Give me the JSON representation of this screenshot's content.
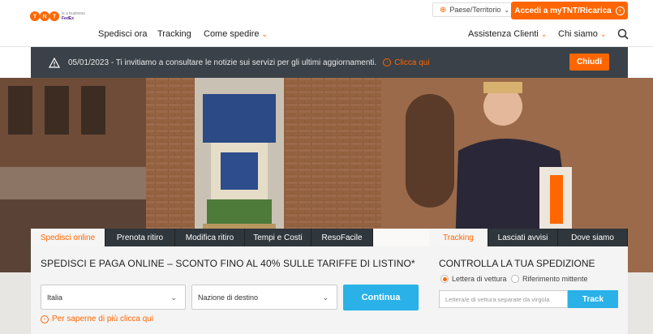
{
  "brand": {
    "logo_text": "TNT",
    "sub_line1": "is a business",
    "sub_line2": "FedEx"
  },
  "header": {
    "country_label": "Paese/Territorio",
    "login_label": "Accedi a myTNT/Ricarica",
    "nav": [
      {
        "label": "Spedisci ora"
      },
      {
        "label": "Tracking"
      },
      {
        "label": "Come spedire"
      },
      {
        "label": "Assistenza Clienti"
      },
      {
        "label": "Chi siamo"
      }
    ]
  },
  "notice": {
    "text": "05/01/2023 - Ti invitiamo a consultare le notizie sui servizi per gli ultimi aggiornamenti.",
    "link_label": "Clicca qui",
    "close_label": "Chiudi"
  },
  "ship_panel": {
    "tabs": [
      "Spedisci online",
      "Prenota ritiro",
      "Modifica ritiro",
      "Tempi e Costi",
      "ResoFacile"
    ],
    "active_tab": 0,
    "title": "SPEDISCI E PAGA ONLINE – SCONTO FINO AL 40% SULLE TARIFFE DI LISTINO*",
    "origin_value": "Italia",
    "destination_value": "Nazione di destino",
    "continue_label": "Continua",
    "more_link": "Per saperne di più clicca qui"
  },
  "track_panel": {
    "tabs": [
      "Tracking",
      "Lasciati avvisi",
      "Dove siamo"
    ],
    "active_tab": 0,
    "title": "CONTROLLA LA TUA SPEDIZIONE",
    "radio_options": [
      "Lettera di vettura",
      "Riferimento mittente"
    ],
    "selected_radio": 0,
    "input_placeholder": "Lettera/e di vettura separate da virgola",
    "track_label": "Track"
  },
  "colors": {
    "accent": "#ff6600",
    "button_blue": "#29b1e8",
    "notice_bg": "#3a4148"
  }
}
